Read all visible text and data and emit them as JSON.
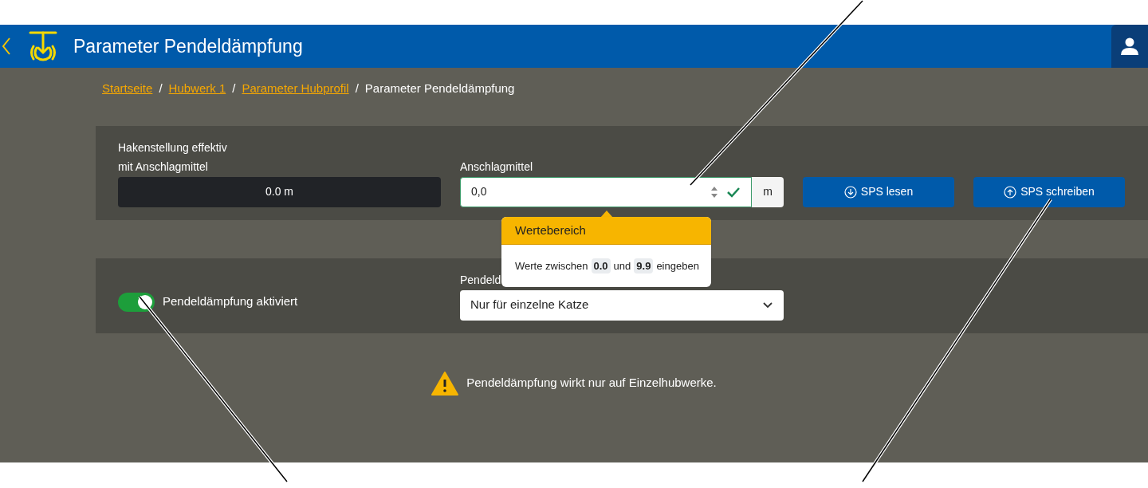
{
  "header": {
    "title": "Parameter Pendeldämpfung"
  },
  "breadcrumb": [
    {
      "label": "Startseite",
      "kind": "link"
    },
    {
      "label": "Hubwerk 1",
      "kind": "link"
    },
    {
      "label": "Parameter Hubprofil",
      "kind": "link"
    },
    {
      "label": "Parameter Pendeldämpfung",
      "kind": "current"
    }
  ],
  "separator": "/",
  "hook_position": {
    "label_lines": [
      "Hakenstellung effektiv",
      "mit Anschlagmittel"
    ],
    "value": "0.0 m"
  },
  "sling": {
    "label": "Anschlagmittel",
    "value": "0,0",
    "valid": true,
    "unit": "m"
  },
  "buttons": [
    {
      "label": "SPS lesen",
      "kind": "read"
    },
    {
      "label": "SPS schreiben",
      "kind": "write"
    }
  ],
  "popover": {
    "title": "Wertebereich",
    "text_before": "Werte zwischen",
    "min": "0.0",
    "text_middle": "und",
    "max": "9.9",
    "text_after": "eingeben"
  },
  "damping": {
    "label": "Pendeldämpfung aktiviert",
    "on": true
  },
  "mode": {
    "label": "Pendeld",
    "value": "Nur für einzelne Katze"
  },
  "warning": "Pendeldämpfung wirkt nur auf Einzelhubwerke."
}
